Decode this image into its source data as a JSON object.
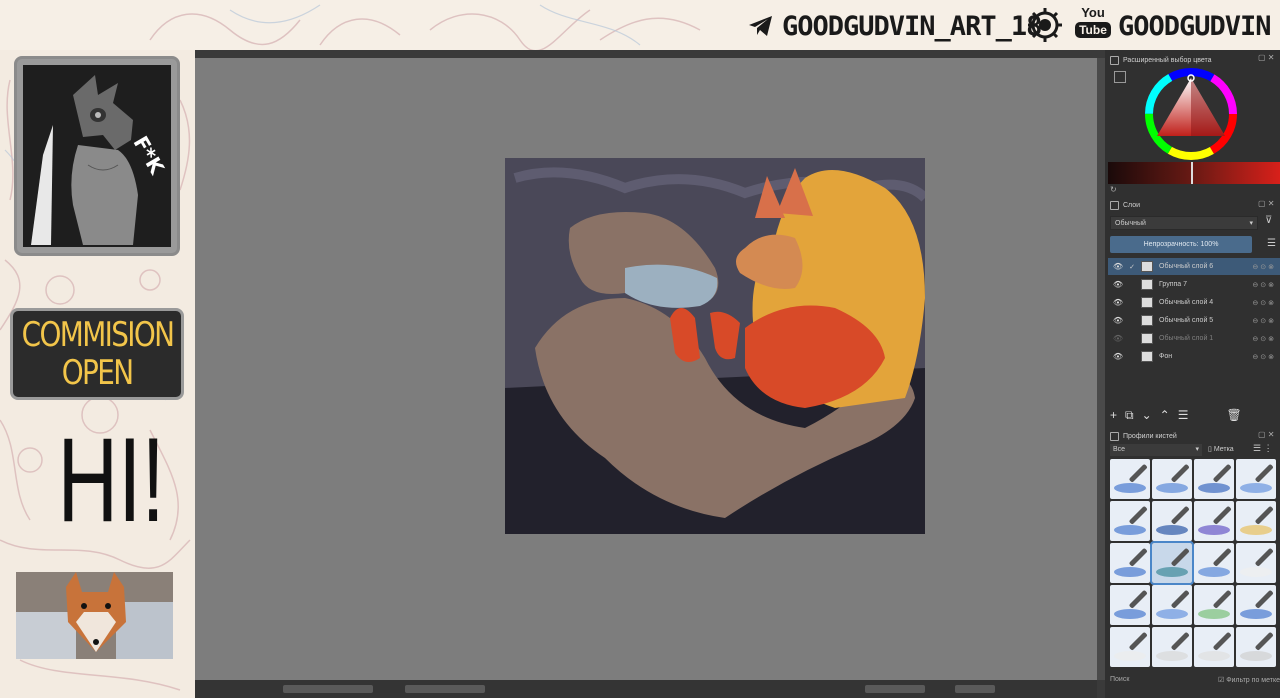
{
  "banner": {
    "telegram_handle": "GOODGUDVIN_ART_18",
    "youtube_handle": "GOODGUDVIN",
    "youtube_logo_top": "You",
    "youtube_logo_bottom": "Tube"
  },
  "left_panel": {
    "avatar_caption": "F*K",
    "commission_line1": "COMMISION",
    "commission_line2": "OPEN",
    "greeting": "HI!"
  },
  "dockers": {
    "color_selector_title": "Расширенный выбор цвета",
    "layers_title": "Слои",
    "blend_mode": "Обычный",
    "opacity_label": "Непрозрачность: 100%",
    "layers": [
      {
        "name": "Обычный слой 6",
        "selected": true,
        "visible": true
      },
      {
        "name": "Группа 7",
        "selected": false,
        "visible": true
      },
      {
        "name": "Обычный слой 4",
        "selected": false,
        "visible": true
      },
      {
        "name": "Обычный слой 5",
        "selected": false,
        "visible": true
      },
      {
        "name": "Обычный слой 1",
        "selected": false,
        "visible": false
      },
      {
        "name": "Фон",
        "selected": false,
        "visible": true
      }
    ],
    "brush_presets_title": "Профили кистей",
    "brush_filter": "Все",
    "brush_tag_label": "Метка",
    "search_placeholder": "Поиск",
    "filter_by_tag": "Фильтр по метке"
  },
  "colors": {
    "accent": "#f2c54a",
    "selection": "#3d5a78",
    "opacity_bar": "#4a6b8c",
    "canvas_bg": "#7d7d7d",
    "panel_bg": "#303030"
  }
}
